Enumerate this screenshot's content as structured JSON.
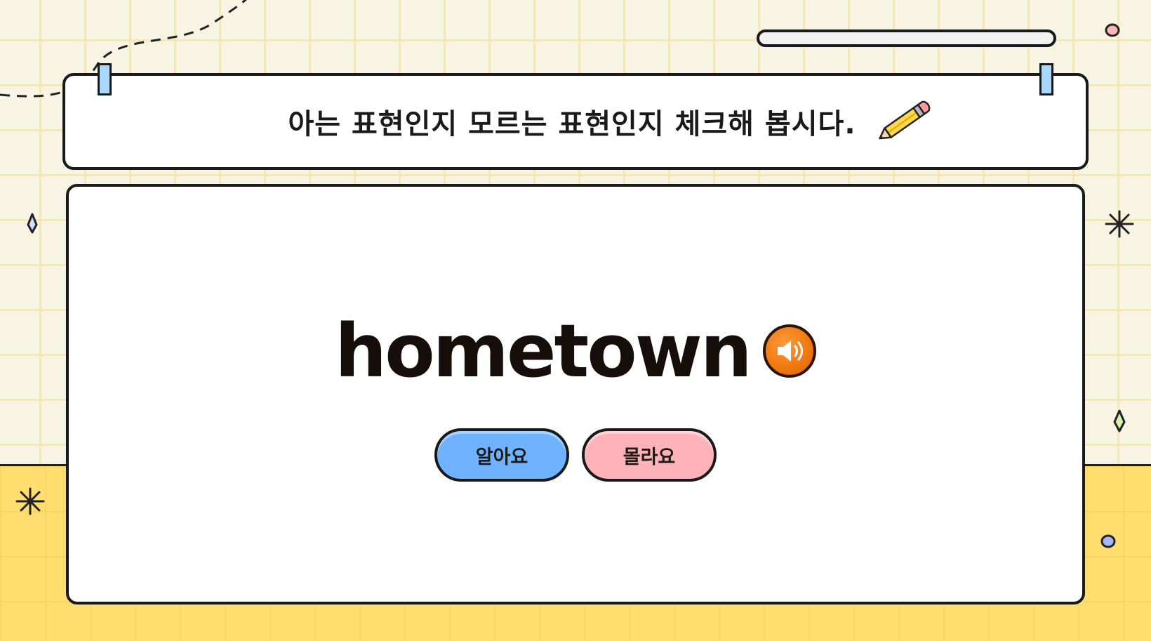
{
  "header": {
    "instruction": "아는 표현인지 모르는 표현인지 체크해 봅시다.",
    "pencil_icon": "pencil-icon"
  },
  "progress": {
    "value": 0
  },
  "card": {
    "word": "hometown",
    "speaker_icon": "speaker-icon"
  },
  "buttons": {
    "know_label": "알아요",
    "dont_know_label": "몰라요"
  },
  "colors": {
    "background": "#f8f4e3",
    "bottom_band": "#ffdd6e",
    "know_button": "#6fb3ff",
    "dont_know_button": "#ffb3b8",
    "speaker": "#f07a10",
    "clip": "#a9d8ff"
  }
}
